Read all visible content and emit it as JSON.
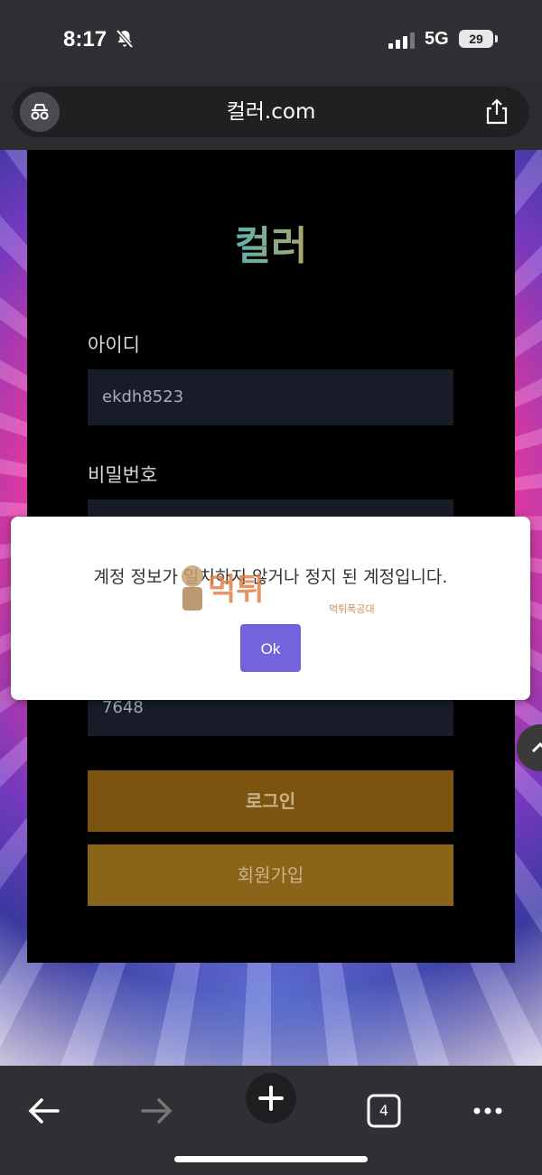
{
  "status": {
    "time": "8:17",
    "network": "5G",
    "battery": "29"
  },
  "browser": {
    "url": "컬러.com",
    "tab_count": "4"
  },
  "site": {
    "logo_text": "컬러",
    "id_label": "아이디",
    "id_value": "ekdh8523",
    "pw_label": "비밀번호",
    "code_value": "7648",
    "login_label": "로그인",
    "signup_label": "회원가입"
  },
  "dialog": {
    "message": "계정 정보가 일치하지 않거나 정지 된 계정입니다.",
    "ok_label": "Ok"
  },
  "watermark": {
    "text": "먹튀",
    "subtext": "먹튀폭공대"
  },
  "colors": {
    "accent": "#7464dc",
    "login_btn": "#7c5410",
    "signup_btn": "#8a6418"
  },
  "icons": [
    "bell-off-icon",
    "signal-icon",
    "incognito-icon",
    "share-icon",
    "back-arrow-icon",
    "forward-arrow-icon",
    "plus-icon",
    "tabs-icon",
    "more-icon",
    "scroll-top-icon"
  ]
}
